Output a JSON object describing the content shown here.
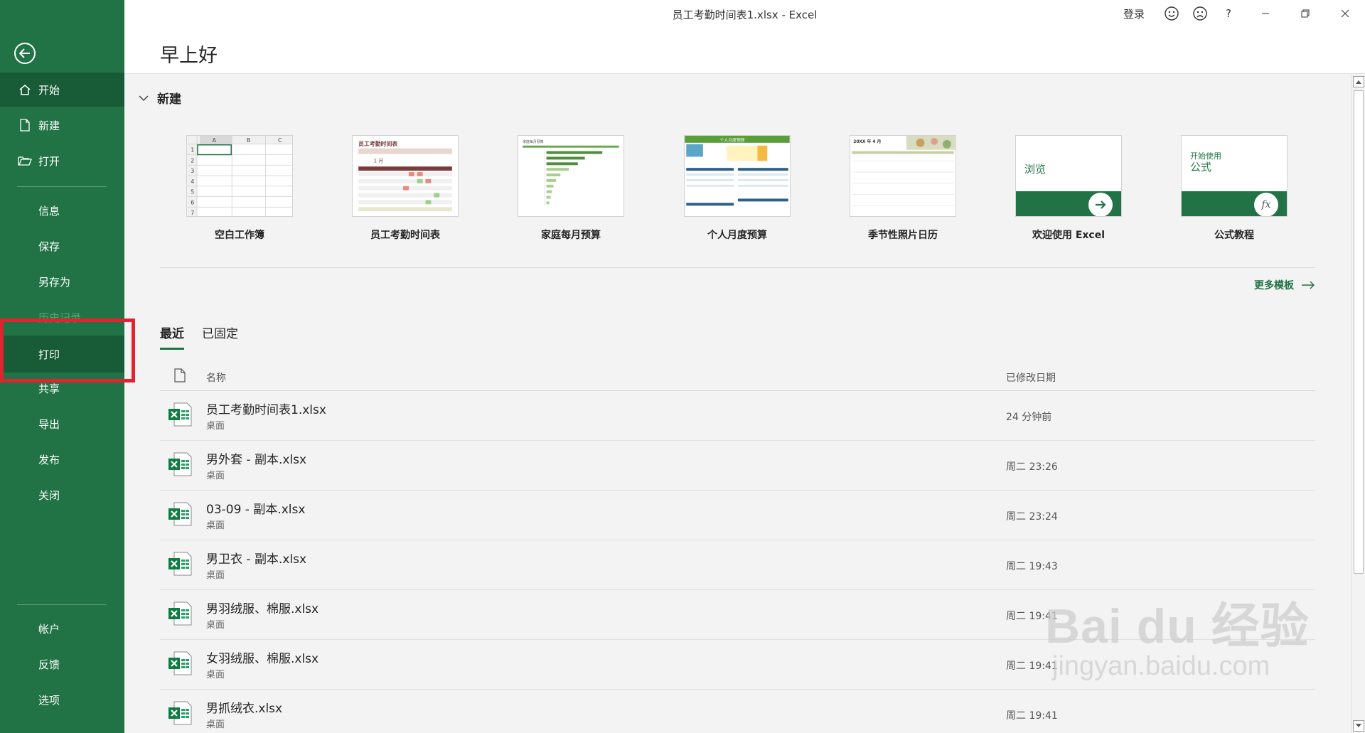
{
  "window": {
    "title": "员工考勤时间表1.xlsx  -  Excel",
    "login": "登录",
    "help": "?"
  },
  "greeting": "早上好",
  "sidebar": {
    "items": [
      {
        "label": "开始"
      },
      {
        "label": "新建"
      },
      {
        "label": "打开"
      },
      {
        "label": "信息"
      },
      {
        "label": "保存"
      },
      {
        "label": "另存为"
      },
      {
        "label": "历史记录"
      },
      {
        "label": "打印"
      },
      {
        "label": "共享"
      },
      {
        "label": "导出"
      },
      {
        "label": "发布"
      },
      {
        "label": "关闭"
      },
      {
        "label": "帐户"
      },
      {
        "label": "反馈"
      },
      {
        "label": "选项"
      }
    ]
  },
  "new_section": {
    "title": "新建",
    "templates": [
      {
        "name": "空白工作簿"
      },
      {
        "name": "员工考勤时间表",
        "thumb_title": "员工考勤时间表",
        "month": "1 月"
      },
      {
        "name": "家庭每月预算",
        "thumb_title": "家庭每月预算"
      },
      {
        "name": "个人月度预算",
        "thumb_title": "个人月度预算"
      },
      {
        "name": "季节性照片日历",
        "thumb_title": "20XX 年 4 月"
      },
      {
        "name": "欢迎使用 Excel",
        "thumb_title": "浏览"
      },
      {
        "name": "公式教程",
        "thumb_title_1": "开始使用",
        "thumb_title_2": "公式",
        "fx": "fx"
      }
    ],
    "more_templates": "更多模板"
  },
  "blank_grid": {
    "cols": [
      "A",
      "B",
      "C"
    ],
    "rows": [
      "1",
      "2",
      "3",
      "4",
      "5",
      "6",
      "7"
    ]
  },
  "recent": {
    "tabs": [
      "最近",
      "已固定"
    ],
    "columns": {
      "name": "名称",
      "date": "已修改日期"
    },
    "files": [
      {
        "name": "员工考勤时间表1.xlsx",
        "location": "桌面",
        "modified": "24 分钟前"
      },
      {
        "name": "男外套 - 副本.xlsx",
        "location": "桌面",
        "modified": "周二 23:26"
      },
      {
        "name": "03-09 - 副本.xlsx",
        "location": "桌面",
        "modified": "周二 23:24"
      },
      {
        "name": "男卫衣 - 副本.xlsx",
        "location": "桌面",
        "modified": "周二 19:43"
      },
      {
        "name": "男羽绒服、棉服.xlsx",
        "location": "桌面",
        "modified": "周二 19:41"
      },
      {
        "name": "女羽绒服、棉服.xlsx",
        "location": "桌面",
        "modified": "周二 19:41"
      },
      {
        "name": "男抓绒衣.xlsx",
        "location": "桌面",
        "modified": "周二 19:41"
      }
    ]
  },
  "watermark": {
    "main": "Bai du 经验",
    "sub": "jingyan.baidu.com"
  },
  "colors": {
    "excel_green": "#217346",
    "dark_green": "#185c37",
    "highlight_red": "#e1232f"
  }
}
